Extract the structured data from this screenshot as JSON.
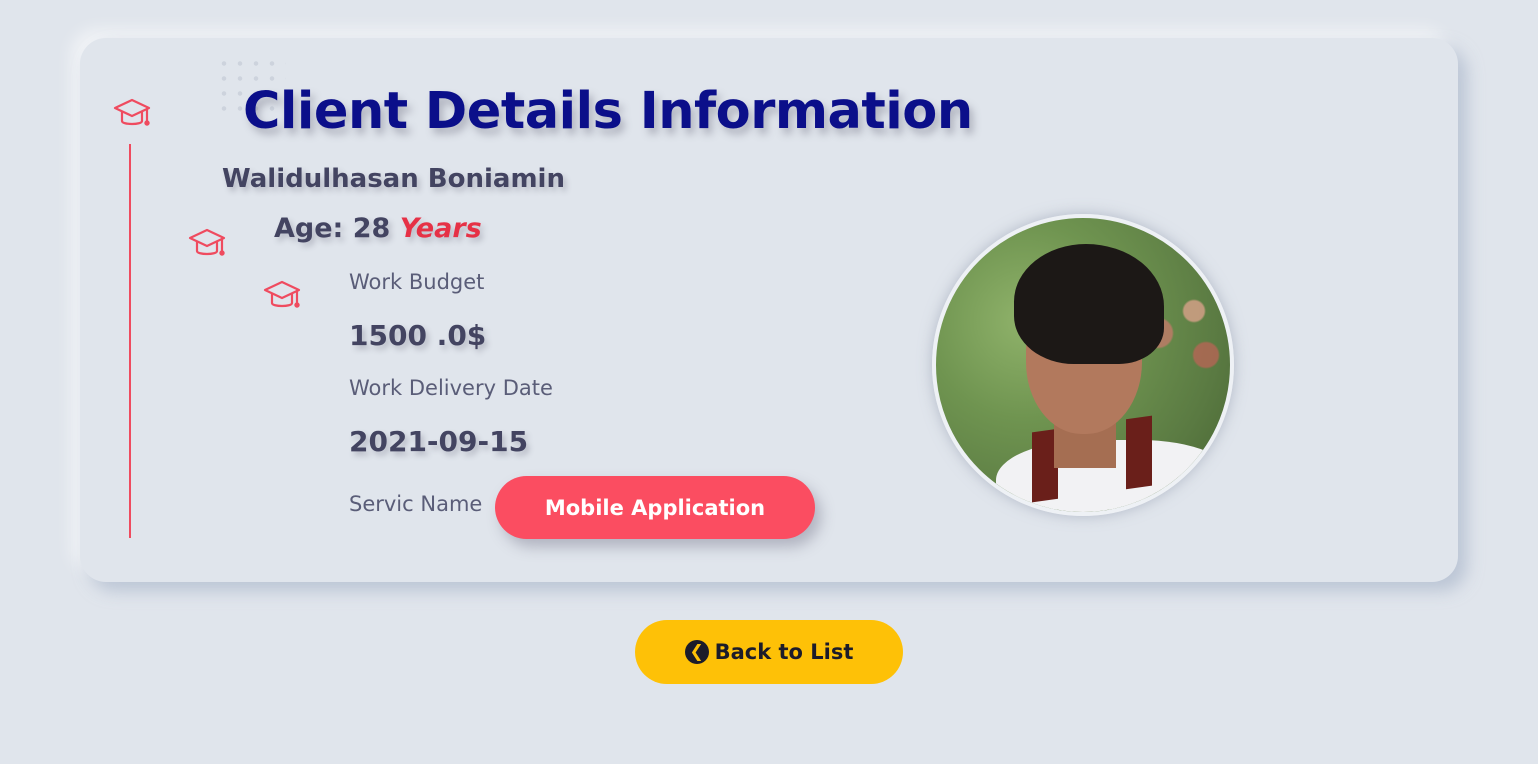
{
  "page": {
    "title": "Client Details Information"
  },
  "client": {
    "name": "Walidulhasan Boniamin",
    "age_label": "Age:",
    "age_value": "28",
    "age_unit": "Years",
    "budget_label": "Work Budget",
    "budget_value": "1500 .0$",
    "delivery_label": "Work Delivery Date",
    "delivery_value": "2021-09-15",
    "service_label": "Servic Name",
    "service_value": "Mobile Application"
  },
  "actions": {
    "back_label": "Back to List",
    "back_icon": "arrow-circle-left-icon"
  },
  "icons": {
    "timeline_icon": "graduation-cap-icon"
  },
  "colors": {
    "background": "#e0e5ec",
    "title": "#0b0f8a",
    "accent_red": "#fb4d61",
    "years": "#e63146",
    "back_button": "#fec107",
    "text": "#434461"
  }
}
